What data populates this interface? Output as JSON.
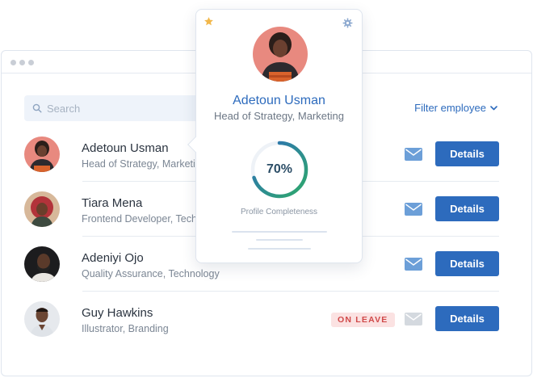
{
  "search": {
    "placeholder": "Search"
  },
  "filter": {
    "label": "Filter employee"
  },
  "employees": [
    {
      "name": "Adetoun Usman",
      "role": "Head of Strategy, Marketing",
      "action": "Details"
    },
    {
      "name": "Tiara Mena",
      "role": "Frontend Developer, Technology",
      "action": "Details"
    },
    {
      "name": "Adeniyi Ojo",
      "role": "Quality Assurance, Technology",
      "action": "Details"
    },
    {
      "name": "Guy Hawkins",
      "role": "Illustrator, Branding",
      "status": "ON LEAVE",
      "action": "Details"
    }
  ],
  "popover": {
    "name": "Adetoun Usman",
    "role": "Head of Strategy, Marketing",
    "completeness_value": "70%",
    "completeness_fraction": 0.7,
    "completeness_label": "Profile Completeness"
  },
  "icons": {
    "star": "star-icon",
    "gear": "gear-icon",
    "mail": "mail-icon",
    "search": "search-icon",
    "chevron": "chevron-down-icon"
  },
  "colors": {
    "accent": "#2d6bbd",
    "progress_start": "#2eaa6a",
    "progress_end": "#2d6bbd",
    "badge_bg": "#fbe2e2",
    "badge_text": "#d04949",
    "star": "#f2b74a"
  }
}
